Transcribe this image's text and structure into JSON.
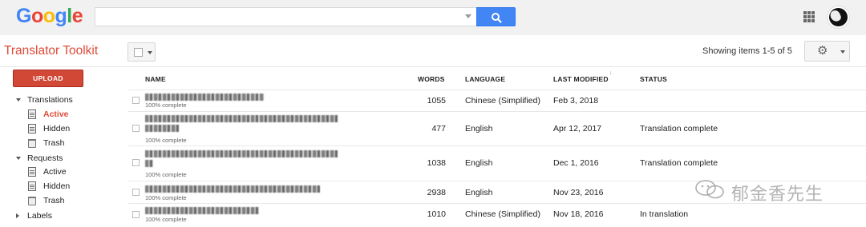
{
  "header": {
    "logo_letters": [
      "G",
      "o",
      "o",
      "g",
      "l",
      "e"
    ],
    "logo_colors": [
      "#4285f4",
      "#ea4335",
      "#fbbc05",
      "#4285f4",
      "#34a853",
      "#ea4335"
    ],
    "search_placeholder": "",
    "accent": "#4285f4"
  },
  "toolbar": {
    "app_title": "Translator Toolkit",
    "showing": "Showing items 1-5 of 5",
    "settings_icon": "gear-icon"
  },
  "sidebar": {
    "upload_label": "UPLOAD",
    "translations": "Translations",
    "translations_items": [
      "Active",
      "Hidden",
      "Trash"
    ],
    "requests": "Requests",
    "requests_items": [
      "Active",
      "Hidden",
      "Trash"
    ],
    "labels": "Labels"
  },
  "table": {
    "columns": [
      "NAME",
      "WORDS",
      "LANGUAGE",
      "LAST MODIFIED",
      "STATUS"
    ],
    "rows": [
      {
        "progress": "100% complete",
        "words": "1055",
        "language": "Chinese (Simplified)",
        "modified": "Feb 3, 2018",
        "status": ""
      },
      {
        "progress": "100% complete",
        "words": "477",
        "language": "English",
        "modified": "Apr 12, 2017",
        "status": "Translation complete"
      },
      {
        "progress": "100% complete",
        "words": "1038",
        "language": "English",
        "modified": "Dec 1, 2016",
        "status": "Translation complete"
      },
      {
        "progress": "100% complete",
        "words": "2938",
        "language": "English",
        "modified": "Nov 23, 2016",
        "status": ""
      },
      {
        "progress": "100% complete",
        "words": "1010",
        "language": "Chinese (Simplified)",
        "modified": "Nov 18, 2016",
        "status": "In translation"
      }
    ]
  },
  "watermark": "郁金香先生"
}
